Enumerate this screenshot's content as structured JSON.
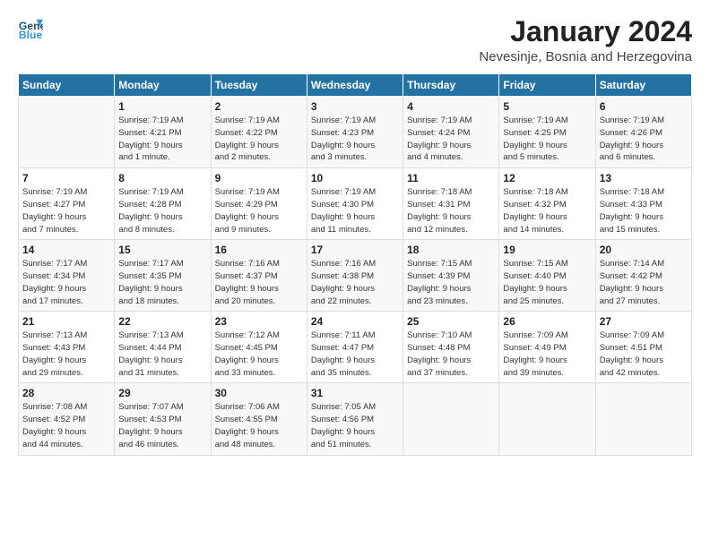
{
  "header": {
    "logo_line1": "General",
    "logo_line2": "Blue",
    "title": "January 2024",
    "subtitle": "Nevesinje, Bosnia and Herzegovina"
  },
  "weekdays": [
    "Sunday",
    "Monday",
    "Tuesday",
    "Wednesday",
    "Thursday",
    "Friday",
    "Saturday"
  ],
  "weeks": [
    [
      {
        "day": "",
        "info": ""
      },
      {
        "day": "1",
        "info": "Sunrise: 7:19 AM\nSunset: 4:21 PM\nDaylight: 9 hours\nand 1 minute."
      },
      {
        "day": "2",
        "info": "Sunrise: 7:19 AM\nSunset: 4:22 PM\nDaylight: 9 hours\nand 2 minutes."
      },
      {
        "day": "3",
        "info": "Sunrise: 7:19 AM\nSunset: 4:23 PM\nDaylight: 9 hours\nand 3 minutes."
      },
      {
        "day": "4",
        "info": "Sunrise: 7:19 AM\nSunset: 4:24 PM\nDaylight: 9 hours\nand 4 minutes."
      },
      {
        "day": "5",
        "info": "Sunrise: 7:19 AM\nSunset: 4:25 PM\nDaylight: 9 hours\nand 5 minutes."
      },
      {
        "day": "6",
        "info": "Sunrise: 7:19 AM\nSunset: 4:26 PM\nDaylight: 9 hours\nand 6 minutes."
      }
    ],
    [
      {
        "day": "7",
        "info": "Sunrise: 7:19 AM\nSunset: 4:27 PM\nDaylight: 9 hours\nand 7 minutes."
      },
      {
        "day": "8",
        "info": "Sunrise: 7:19 AM\nSunset: 4:28 PM\nDaylight: 9 hours\nand 8 minutes."
      },
      {
        "day": "9",
        "info": "Sunrise: 7:19 AM\nSunset: 4:29 PM\nDaylight: 9 hours\nand 9 minutes."
      },
      {
        "day": "10",
        "info": "Sunrise: 7:19 AM\nSunset: 4:30 PM\nDaylight: 9 hours\nand 11 minutes."
      },
      {
        "day": "11",
        "info": "Sunrise: 7:18 AM\nSunset: 4:31 PM\nDaylight: 9 hours\nand 12 minutes."
      },
      {
        "day": "12",
        "info": "Sunrise: 7:18 AM\nSunset: 4:32 PM\nDaylight: 9 hours\nand 14 minutes."
      },
      {
        "day": "13",
        "info": "Sunrise: 7:18 AM\nSunset: 4:33 PM\nDaylight: 9 hours\nand 15 minutes."
      }
    ],
    [
      {
        "day": "14",
        "info": "Sunrise: 7:17 AM\nSunset: 4:34 PM\nDaylight: 9 hours\nand 17 minutes."
      },
      {
        "day": "15",
        "info": "Sunrise: 7:17 AM\nSunset: 4:35 PM\nDaylight: 9 hours\nand 18 minutes."
      },
      {
        "day": "16",
        "info": "Sunrise: 7:16 AM\nSunset: 4:37 PM\nDaylight: 9 hours\nand 20 minutes."
      },
      {
        "day": "17",
        "info": "Sunrise: 7:16 AM\nSunset: 4:38 PM\nDaylight: 9 hours\nand 22 minutes."
      },
      {
        "day": "18",
        "info": "Sunrise: 7:15 AM\nSunset: 4:39 PM\nDaylight: 9 hours\nand 23 minutes."
      },
      {
        "day": "19",
        "info": "Sunrise: 7:15 AM\nSunset: 4:40 PM\nDaylight: 9 hours\nand 25 minutes."
      },
      {
        "day": "20",
        "info": "Sunrise: 7:14 AM\nSunset: 4:42 PM\nDaylight: 9 hours\nand 27 minutes."
      }
    ],
    [
      {
        "day": "21",
        "info": "Sunrise: 7:13 AM\nSunset: 4:43 PM\nDaylight: 9 hours\nand 29 minutes."
      },
      {
        "day": "22",
        "info": "Sunrise: 7:13 AM\nSunset: 4:44 PM\nDaylight: 9 hours\nand 31 minutes."
      },
      {
        "day": "23",
        "info": "Sunrise: 7:12 AM\nSunset: 4:45 PM\nDaylight: 9 hours\nand 33 minutes."
      },
      {
        "day": "24",
        "info": "Sunrise: 7:11 AM\nSunset: 4:47 PM\nDaylight: 9 hours\nand 35 minutes."
      },
      {
        "day": "25",
        "info": "Sunrise: 7:10 AM\nSunset: 4:48 PM\nDaylight: 9 hours\nand 37 minutes."
      },
      {
        "day": "26",
        "info": "Sunrise: 7:09 AM\nSunset: 4:49 PM\nDaylight: 9 hours\nand 39 minutes."
      },
      {
        "day": "27",
        "info": "Sunrise: 7:09 AM\nSunset: 4:51 PM\nDaylight: 9 hours\nand 42 minutes."
      }
    ],
    [
      {
        "day": "28",
        "info": "Sunrise: 7:08 AM\nSunset: 4:52 PM\nDaylight: 9 hours\nand 44 minutes."
      },
      {
        "day": "29",
        "info": "Sunrise: 7:07 AM\nSunset: 4:53 PM\nDaylight: 9 hours\nand 46 minutes."
      },
      {
        "day": "30",
        "info": "Sunrise: 7:06 AM\nSunset: 4:55 PM\nDaylight: 9 hours\nand 48 minutes."
      },
      {
        "day": "31",
        "info": "Sunrise: 7:05 AM\nSunset: 4:56 PM\nDaylight: 9 hours\nand 51 minutes."
      },
      {
        "day": "",
        "info": ""
      },
      {
        "day": "",
        "info": ""
      },
      {
        "day": "",
        "info": ""
      }
    ]
  ]
}
